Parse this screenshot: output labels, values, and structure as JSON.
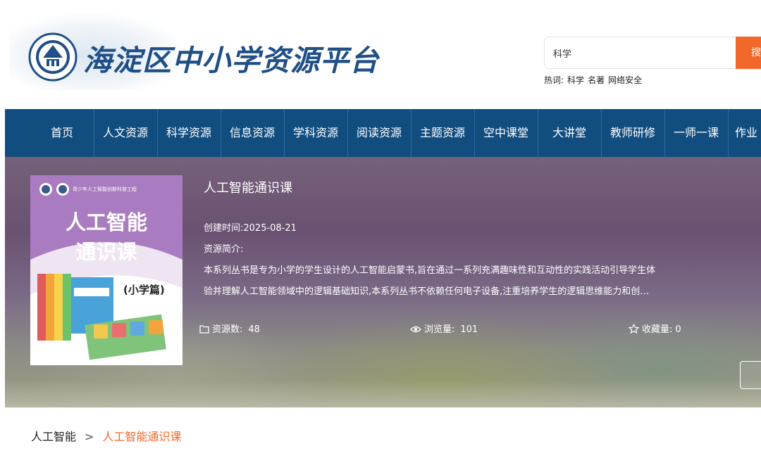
{
  "header": {
    "title": "海淀区中小学资源平台",
    "logo_icon": "haidian-education-seal-icon",
    "search": {
      "value": "科学",
      "button_label": "搜"
    },
    "hotwords_label": "热词:",
    "hotwords": [
      "科学",
      "名著",
      "网络安全"
    ]
  },
  "nav": {
    "items": [
      "首页",
      "人文资源",
      "科学资源",
      "信息资源",
      "学科资源",
      "阅读资源",
      "主题资源",
      "空中课堂",
      "大讲堂",
      "教师研修",
      "一师一课",
      "作业"
    ]
  },
  "resource": {
    "cover": {
      "top_text": "青少年人工智能创新科普工程",
      "title_line1": "人工智能",
      "title_line2": "通识课",
      "subtitle": "(小学篇)"
    },
    "title": "人工智能通识课",
    "created_label": "创建时间:",
    "created_value": "2025-08-21",
    "intro_label": "资源简介:",
    "intro_line1": "本系列丛书是专为小学的学生设计的人工智能启蒙书,旨在通过一系列充满趣味性和互动性的实践活动引导学生体",
    "intro_line2": "验并理解人工智能领域中的逻辑基础知识,本系列丛书不依赖任何电子设备,注重培养学生的逻辑思维能力和创…",
    "stats": {
      "resources_label": "资源数:",
      "resources_value": "48",
      "views_label": "浏览量:",
      "views_value": "101",
      "favorites_label": "收藏量:",
      "favorites_value": "0"
    }
  },
  "breadcrumb": {
    "parent": "人工智能",
    "separator": ">",
    "current": "人工智能通识课"
  },
  "colors": {
    "nav_bg": "#124d80",
    "accent": "#f2682a",
    "title_blue": "#1f4f86",
    "cover_purple": "#a97bc0"
  }
}
